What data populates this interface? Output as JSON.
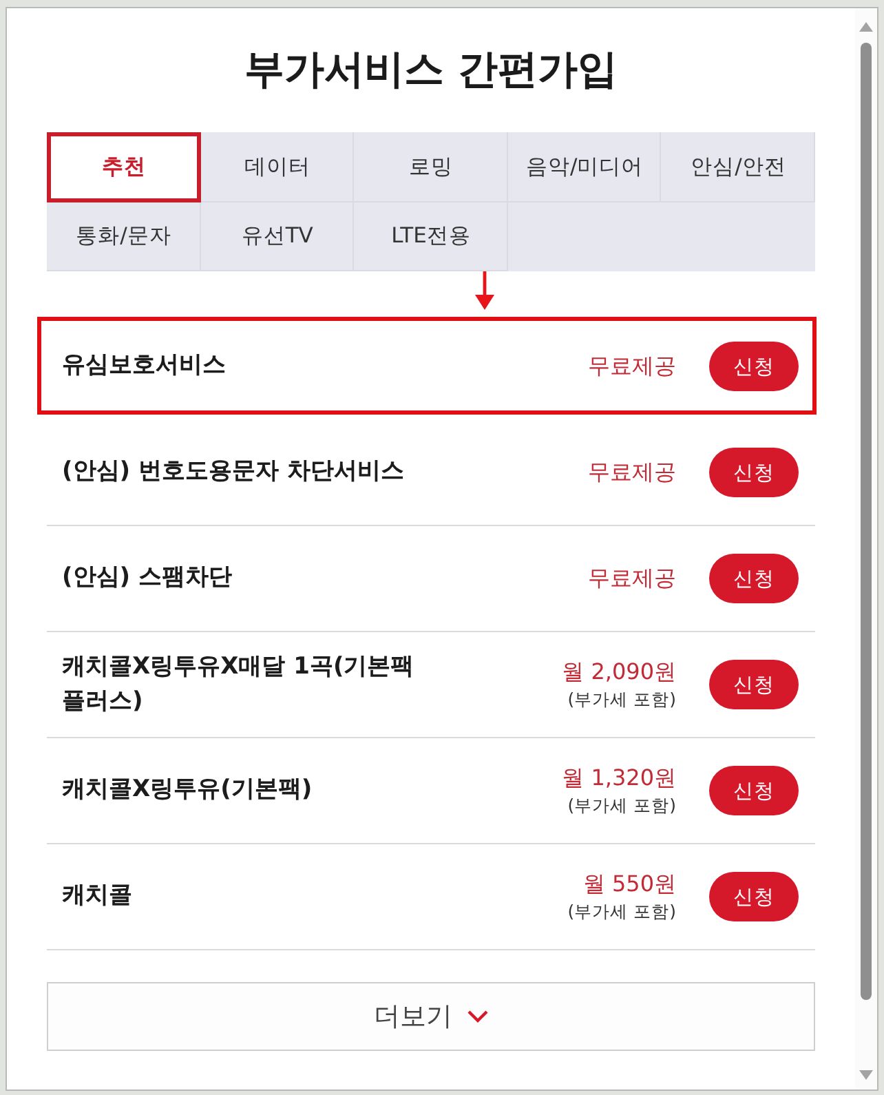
{
  "title": "부가서비스 간편가입",
  "tabs": [
    {
      "label": "추천",
      "selected": true
    },
    {
      "label": "데이터",
      "selected": false
    },
    {
      "label": "로밍",
      "selected": false
    },
    {
      "label": "음악/미디어",
      "selected": false
    },
    {
      "label": "안심/안전",
      "selected": false
    },
    {
      "label": "통화/문자",
      "selected": false
    },
    {
      "label": "유선TV",
      "selected": false
    },
    {
      "label": "LTE전용",
      "selected": false
    }
  ],
  "annotation_arrow": true,
  "services": [
    {
      "name": "유심보호서비스",
      "price": "무료제공",
      "button": "신청",
      "highlighted": true
    },
    {
      "name": "(안심) 번호도용문자 차단서비스",
      "price": "무료제공",
      "button": "신청",
      "highlighted": false
    },
    {
      "name": "(안심) 스팸차단",
      "price": "무료제공",
      "button": "신청",
      "highlighted": false
    },
    {
      "name": "캐치콜X링투유X매달 1곡(기본팩 플러스)",
      "price": "월 2,090원",
      "note": "(부가세 포함)",
      "button": "신청",
      "highlighted": false
    },
    {
      "name": "캐치콜X링투유(기본팩)",
      "price": "월 1,320원",
      "note": "(부가세 포함)",
      "button": "신청",
      "highlighted": false
    },
    {
      "name": "캐치콜",
      "price": "월 550원",
      "note": "(부가세 포함)",
      "button": "신청",
      "highlighted": false
    }
  ],
  "more_button": {
    "label": "더보기"
  }
}
